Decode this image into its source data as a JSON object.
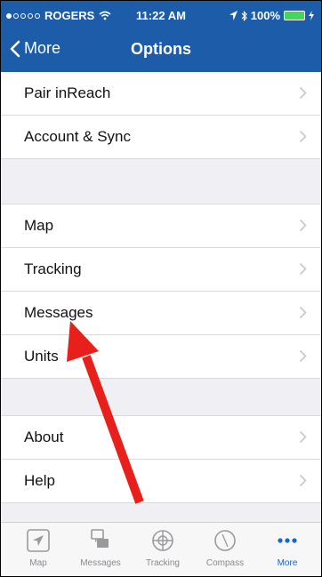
{
  "status": {
    "carrier": "ROGERS",
    "time": "11:22 AM",
    "battery": "100%"
  },
  "nav": {
    "back_label": "More",
    "title": "Options"
  },
  "sections": [
    [
      {
        "label": "Pair inReach"
      },
      {
        "label": "Account & Sync"
      }
    ],
    [
      {
        "label": "Map"
      },
      {
        "label": "Tracking"
      },
      {
        "label": "Messages"
      },
      {
        "label": "Units"
      }
    ],
    [
      {
        "label": "About"
      },
      {
        "label": "Help"
      }
    ]
  ],
  "tabbar": {
    "tabs": [
      {
        "label": "Map",
        "icon": "map-arrow-icon"
      },
      {
        "label": "Messages",
        "icon": "messages-icon"
      },
      {
        "label": "Tracking",
        "icon": "tracking-icon"
      },
      {
        "label": "Compass",
        "icon": "compass-icon"
      },
      {
        "label": "More",
        "icon": "more-icon",
        "active": true
      }
    ]
  },
  "colors": {
    "header": "#1c5ca8",
    "active_tab": "#1a63d2",
    "annotation_arrow": "#e8201c",
    "battery": "#44d55a"
  }
}
